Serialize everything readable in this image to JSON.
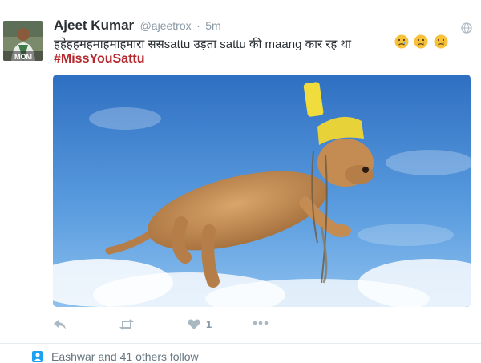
{
  "tweet": {
    "author_name": "Ajeet Kumar",
    "author_handle": "@ajeetrox",
    "separator": "·",
    "timestamp": "5m",
    "text": "हहेहहमहमाहमाहमारा ससsattu उड़ता sattu की maang कार रह था",
    "hashtag": "#MissYouSattu",
    "like_count": "1",
    "avatar_badge": "MOM"
  },
  "footer": {
    "follow_text": "Eashwar and 41 others follow"
  },
  "icons": {
    "reply": "reply-icon",
    "retweet": "retweet-icon",
    "like": "heart-icon",
    "more": "more-icon",
    "globe": "globe-icon",
    "follow": "person-icon"
  },
  "colors": {
    "hashtag": "#b5282d",
    "muted": "#8899a6",
    "divider": "#e6ecf0",
    "follow_icon": "#1da1f2"
  }
}
